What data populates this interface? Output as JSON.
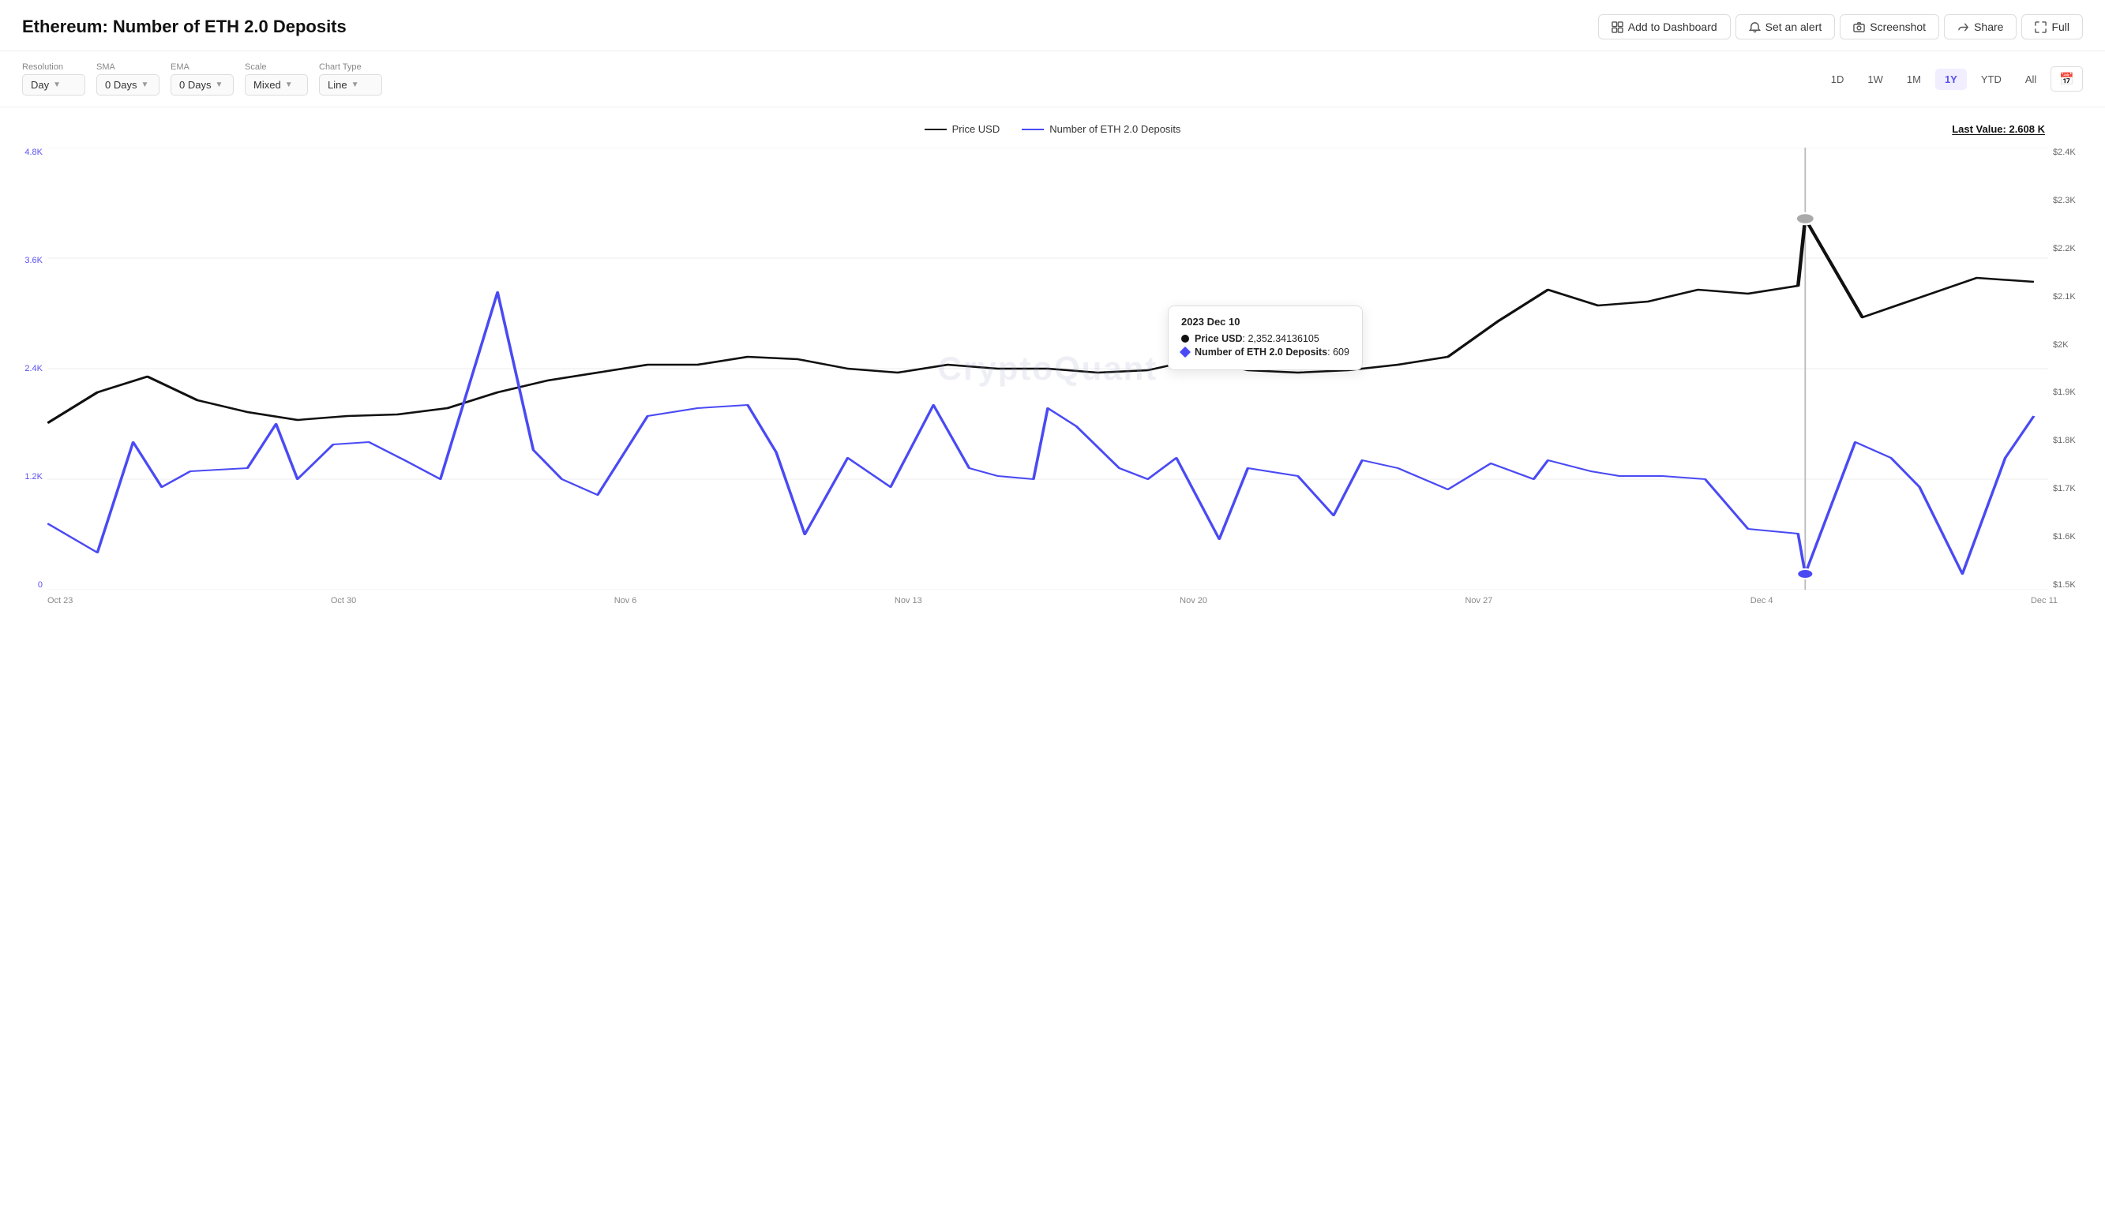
{
  "header": {
    "title": "Ethereum: Number of ETH 2.0 Deposits",
    "actions": [
      {
        "id": "add-dashboard",
        "label": "Add to Dashboard",
        "icon": "dashboard"
      },
      {
        "id": "set-alert",
        "label": "Set an alert",
        "icon": "bell"
      },
      {
        "id": "screenshot",
        "label": "Screenshot",
        "icon": "camera"
      },
      {
        "id": "share",
        "label": "Share",
        "icon": "share"
      },
      {
        "id": "full",
        "label": "Full",
        "icon": "expand"
      }
    ]
  },
  "toolbar": {
    "resolution": {
      "label": "Resolution",
      "value": "Day"
    },
    "sma": {
      "label": "SMA",
      "value": "0 Days"
    },
    "ema": {
      "label": "EMA",
      "value": "0 Days"
    },
    "scale": {
      "label": "Scale",
      "value": "Mixed"
    },
    "chartType": {
      "label": "Chart Type",
      "value": "Line"
    },
    "timeBtns": [
      "1D",
      "1W",
      "1M",
      "1Y",
      "YTD",
      "All"
    ],
    "activeTime": "1Y"
  },
  "legend": {
    "priceLabel": "Price USD",
    "depositsLabel": "Number of ETH 2.0 Deposits"
  },
  "lastValue": "Last Value: 2.608 K",
  "yAxisLeft": [
    "4.8K",
    "3.6K",
    "2.4K",
    "1.2K",
    "0"
  ],
  "yAxisRight": [
    "$2.4K",
    "$2.3K",
    "$2.2K",
    "$2.1K",
    "$2K",
    "$1.9K",
    "$1.8K",
    "$1.7K",
    "$1.6K",
    "$1.5K"
  ],
  "xAxis": [
    "Oct 23",
    "Oct 30",
    "Nov 6",
    "Nov 13",
    "Nov 20",
    "Nov 27",
    "Dec 4",
    "Dec 11"
  ],
  "tooltip": {
    "date": "2023 Dec 10",
    "priceLabel": "Price USD",
    "priceValue": "2,352.34136105",
    "depositsLabel": "Number of ETH 2.0 Deposits",
    "depositsValue": "609"
  },
  "watermark": "CryptoQuant",
  "chartColors": {
    "black": "#111111",
    "blue": "#4a4af4",
    "accent": "#5b50f0"
  }
}
